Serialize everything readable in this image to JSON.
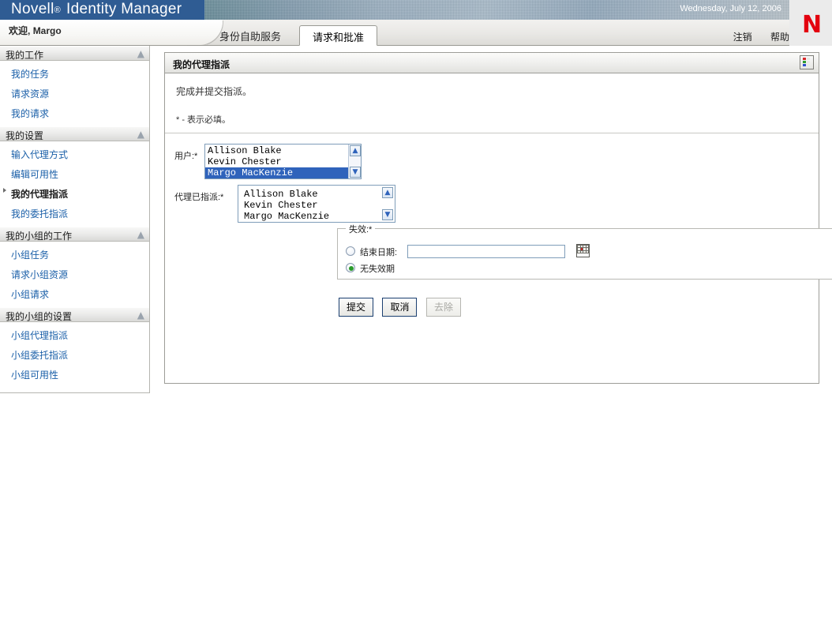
{
  "banner": {
    "product_brand": "Novell",
    "registered_mark": "®",
    "product_name": "Identity Manager",
    "date": "Wednesday, July 12, 2006",
    "logo_letter": "N",
    "logo_color": "#e3000f",
    "brand_blue": "#2f5c93"
  },
  "welcome": {
    "greeting": "欢迎",
    "separator": ", ",
    "user": "Margo"
  },
  "tabs": [
    {
      "label": "身份自助服务",
      "active": false
    },
    {
      "label": "请求和批准",
      "active": true
    }
  ],
  "header_links": [
    {
      "label": "注销"
    },
    {
      "label": "帮助"
    }
  ],
  "sidebar": {
    "groups": [
      {
        "title": "我的工作",
        "collapse_icon": "chevron-up-icon",
        "items": [
          {
            "label": "我的任务",
            "current": false
          },
          {
            "label": "请求资源",
            "current": false
          },
          {
            "label": "我的请求",
            "current": false
          }
        ]
      },
      {
        "title": "我的设置",
        "collapse_icon": "chevron-up-icon",
        "items": [
          {
            "label": "输入代理方式",
            "current": false
          },
          {
            "label": "编辑可用性",
            "current": false
          },
          {
            "label": "我的代理指派",
            "current": true
          },
          {
            "label": "我的委托指派",
            "current": false
          }
        ]
      },
      {
        "title": "我的小组的工作",
        "collapse_icon": "chevron-up-icon",
        "items": [
          {
            "label": "小组任务",
            "current": false
          },
          {
            "label": "请求小组资源",
            "current": false
          },
          {
            "label": "小组请求",
            "current": false
          }
        ]
      },
      {
        "title": "我的小组的设置",
        "collapse_icon": "chevron-up-icon",
        "items": [
          {
            "label": "小组代理指派",
            "current": false
          },
          {
            "label": "小组委托指派",
            "current": false
          },
          {
            "label": "小组可用性",
            "current": false
          }
        ]
      }
    ]
  },
  "panel": {
    "title": "我的代理指派",
    "legend_icon": "color-legend-icon",
    "legend_colors": [
      "#e03232",
      "#2f9b2f",
      "#2f4fcc",
      "#888888"
    ],
    "intro_line1": "完成并提交指派。",
    "intro_line2": "* - 表示必填。"
  },
  "form": {
    "user_field": {
      "label": "用户:*",
      "options": [
        "Allison Blake",
        "Kevin Chester",
        "Margo MacKenzie"
      ],
      "selected": "Margo MacKenzie",
      "scroll_up_icon": "chevron-up-icon",
      "scroll_down_icon": "chevron-down-icon"
    },
    "assigned_field": {
      "label": "代理已指派:*",
      "options": [
        "Allison Blake",
        "Kevin Chester",
        "Margo MacKenzie"
      ],
      "selected": null,
      "scroll_up_icon": "chevron-up-icon",
      "scroll_down_icon": "chevron-down-icon"
    },
    "expiration": {
      "legend": "失效:*",
      "end_date": {
        "label": "结束日期:",
        "value": "",
        "placeholder": "",
        "selected": false,
        "calendar_icon": "calendar-icon"
      },
      "no_expiration": {
        "label": "无失效期",
        "selected": true
      }
    },
    "buttons": [
      {
        "label": "提交",
        "name": "submit-button",
        "disabled": false
      },
      {
        "label": "取消",
        "name": "cancel-button",
        "disabled": false
      },
      {
        "label": "去除",
        "name": "remove-button",
        "disabled": true
      }
    ]
  }
}
